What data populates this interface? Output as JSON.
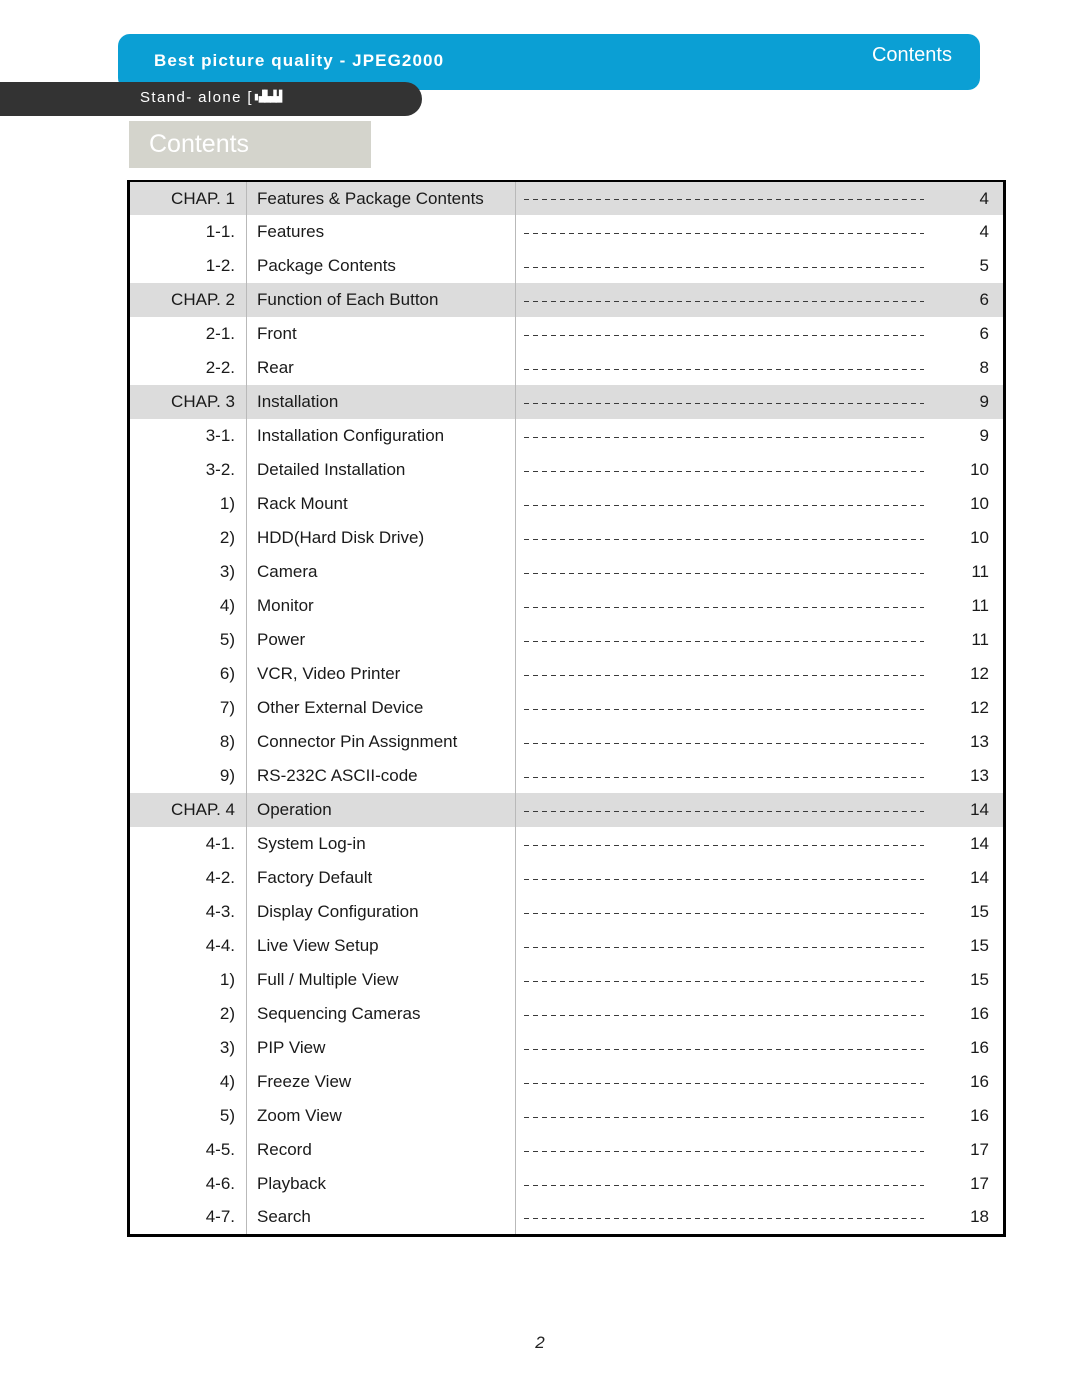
{
  "header": {
    "tagline": "Best picture quality -  JPEG2000",
    "section_label": "Contents",
    "band_color": "#0b9fd4",
    "product_prefix": "Stand- alone [",
    "product_glyphs": "▮▟▙▟▟",
    "product_bar_color": "#333333"
  },
  "page_title": {
    "text": "Contents",
    "box_color": "#d4d4cc",
    "text_color": "#ffffff"
  },
  "toc": {
    "chapter_row_color": "#dcdcdc",
    "rows": [
      {
        "type": "chapter",
        "num": "CHAP. 1",
        "title": "Features & Package Contents",
        "page": "4"
      },
      {
        "type": "sub",
        "num": "1-1.",
        "title": "Features",
        "page": "4"
      },
      {
        "type": "sub",
        "num": "1-2.",
        "title": "Package Contents",
        "page": "5"
      },
      {
        "type": "chapter",
        "num": "CHAP. 2",
        "title": "Function of Each Button",
        "page": "6"
      },
      {
        "type": "sub",
        "num": "2-1.",
        "title": "Front",
        "page": "6"
      },
      {
        "type": "sub",
        "num": "2-2.",
        "title": "Rear",
        "page": "8"
      },
      {
        "type": "chapter",
        "num": "CHAP. 3",
        "title": "Installation",
        "page": "9"
      },
      {
        "type": "sub",
        "num": "3-1.",
        "title": "Installation Configuration",
        "page": "9"
      },
      {
        "type": "sub",
        "num": "3-2.",
        "title": "Detailed Installation",
        "page": "10"
      },
      {
        "type": "sub",
        "num": "1)",
        "title": "Rack Mount",
        "page": "10"
      },
      {
        "type": "sub",
        "num": "2)",
        "title": "HDD(Hard Disk Drive)",
        "page": "10"
      },
      {
        "type": "sub",
        "num": "3)",
        "title": "Camera",
        "page": "11"
      },
      {
        "type": "sub",
        "num": "4)",
        "title": "Monitor",
        "page": "11"
      },
      {
        "type": "sub",
        "num": "5)",
        "title": "Power",
        "page": "11"
      },
      {
        "type": "sub",
        "num": "6)",
        "title": "VCR, Video Printer",
        "page": "12"
      },
      {
        "type": "sub",
        "num": "7)",
        "title": "Other External Device",
        "page": "12"
      },
      {
        "type": "sub",
        "num": "8)",
        "title": "Connector Pin Assignment",
        "page": "13"
      },
      {
        "type": "sub",
        "num": "9)",
        "title": "RS-232C ASCII-code",
        "page": "13"
      },
      {
        "type": "chapter",
        "num": "CHAP. 4",
        "title": "Operation",
        "page": "14"
      },
      {
        "type": "sub",
        "num": "4-1.",
        "title": "System Log-in",
        "page": "14"
      },
      {
        "type": "sub",
        "num": "4-2.",
        "title": "Factory Default",
        "page": "14"
      },
      {
        "type": "sub",
        "num": "4-3.",
        "title": "Display Configuration",
        "page": "15"
      },
      {
        "type": "sub",
        "num": "4-4.",
        "title": "Live View Setup",
        "page": "15"
      },
      {
        "type": "sub",
        "num": "1)",
        "title": "Full / Multiple View",
        "page": "15"
      },
      {
        "type": "sub",
        "num": "2)",
        "title": "Sequencing Cameras",
        "page": "16"
      },
      {
        "type": "sub",
        "num": "3)",
        "title": "PIP View",
        "page": "16"
      },
      {
        "type": "sub",
        "num": "4)",
        "title": "Freeze View",
        "page": "16"
      },
      {
        "type": "sub",
        "num": "5)",
        "title": "Zoom View",
        "page": "16"
      },
      {
        "type": "sub",
        "num": "4-5.",
        "title": "Record",
        "page": "17"
      },
      {
        "type": "sub",
        "num": "4-6.",
        "title": "Playback",
        "page": "17"
      },
      {
        "type": "sub",
        "num": "4-7.",
        "title": "Search",
        "page": "18"
      }
    ]
  },
  "footer": {
    "page_number": "2"
  }
}
